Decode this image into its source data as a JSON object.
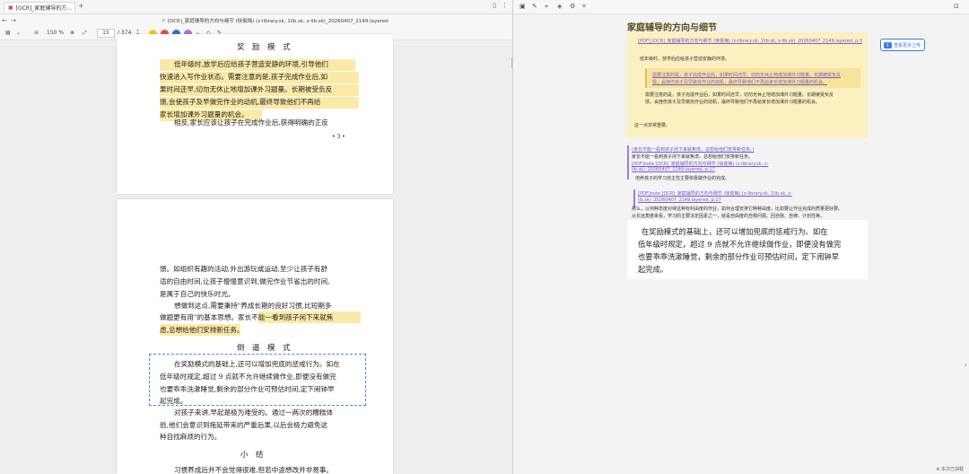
{
  "left": {
    "tab_title": "[OCR]_家庭辅导的方...",
    "doc_title": "[OCR]_家庭辅导的方向与细节 (徐俊梅) (z-library.sk, 1lib.sk, z-lib.sk)_20260407_2149.layered",
    "zoom": "150 %",
    "page_current": "15",
    "page_total": "/ 374",
    "highlight_colors": [
      "#f5c518",
      "#e84b4b",
      "#2b6fd6",
      "#b06cd8"
    ],
    "page1": {
      "heading": "奖 励 模 式",
      "lines": [
        "低年级时,放学后应给孩子营造安静的环境,引导他们",
        "快速进入写作业状态。需要注意的是,孩子完成作业后,如",
        "果时间还早,切勿无休止地增加课外习题量。长期被受负反",
        "馈,会使孩子及早做完作业的动机,最终导致他们不再给",
        "家长增加课外习题量的机会。",
        "相反,家长应该让孩子在完成作业后,获得明确的正反"
      ],
      "page_number": "• 3 •"
    },
    "page2": {
      "lines_top": [
        "馈。如组织有趣的活动,外出游玩或运动,至少让孩子有舒",
        "适的自由时间,让孩子慢慢意识到,做完作业节省出的时间,",
        "是属于自己的快乐时光。",
        "想做到这点,需要秉持\"养成长期的良好习惯,比短期多",
        "做题更有用\"的基本思想。家长不能一看到孩子闲下来就焦",
        "虑,总想给他们安排新任务。"
      ],
      "heading2": "倒 逼 模 式",
      "selected_lines": [
        "在奖励模式的基础上,还可以增加兜底的惩戒行为。如在",
        "低年级时规定,超过 9 点就不允许继续做作业,即便没有做完",
        "也要乖乖洗漱睡觉,剩余的部分作业可预估时间,定下闹钟早",
        "起完成。"
      ],
      "lines_after": [
        "对孩子来讲,早起是极为难受的。通过一两次的糟糕体",
        "验,他们会意识到拖延带来的严重后果,以后会极力避免这",
        "种自找麻烦的行为。"
      ],
      "heading3": "小      结",
      "last_line": "习惯养成后并不会觉得很难,但若中途想改并非易事。"
    }
  },
  "right": {
    "title": "家庭辅导的方向与细节",
    "link1": "[PDF] [OCR]_家庭辅导的方向与细节 (徐俊梅) (z-library.sk, 1lib.sk, z-lib.sk)_20260407_2149.layered, p.3",
    "quote1": "低年级时，放学后应给孩子营造安静的环境。",
    "block_lines": [
      "需要注意的是，孩子完成作业后，如果时间还早，切勿无休止地增加课外习题量。长期被受负反",
      "馈，会挫伤孩子及早做完作业的动机，最终导致他们不再给家长增加课外习题量的机会。"
    ],
    "quote2_lines": [
      "需要注意的是，孩子完成作业后，如果时间还早，切勿无休止地增加课外习题量。长期被受负反",
      "馈，会挫伤孩子及早做完作业的动机，最终导致他们不再给家长增加课外习题量的机会。"
    ],
    "note1": "这一点非常重要。",
    "button_label": "查看更多上传",
    "sec2_link": "(家长不能一看到孩子闲下来就焦虑，总想给他们安排新任务。)",
    "sec2_text": "家长不能一看到孩子闲下来就焦虑，总想给他们安排新任务。",
    "sec2_link2a": "[PDF]note [OCR]_家庭辅导的方向与细节 (徐俊梅) (z-library.sk, z-",
    "sec2_link2b": "lib.sk)_20260407_2149.layered, p.17",
    "sec2_text2": "培养孩子的学习自主性主要依靠做作业的完成。",
    "sec3_link_a": "[PDF]note [OCR]_家庭辅导的方向与细节 (徐俊梅) (z-library.sk, 1lib.sk, z-",
    "sec3_link_b": "lib.sk)_20260407_2149.layered, p.17",
    "sec3_text1": "那么，以何种态度对待这种有利由度的作业，如何合理安排它种种由度。比如要让作业完成的质量更好要。",
    "sec3_text2": "从长远角度来看，学习的主要决定因素之一，就是自由度的自我问题、回自我、自律、计划性等。",
    "big_lines": [
      "在奖励模式的基础上，还可以增加兜底的惩戒行为。如在",
      "低年级时规定，超过 9 点就不允许继续做作业，即便没有做完",
      "也要乖乖洗漱睡觉，剩余的部分作业可预估时间，定下闹钟早",
      "起完成。"
    ],
    "footer": "⊕ 本次已加载"
  }
}
